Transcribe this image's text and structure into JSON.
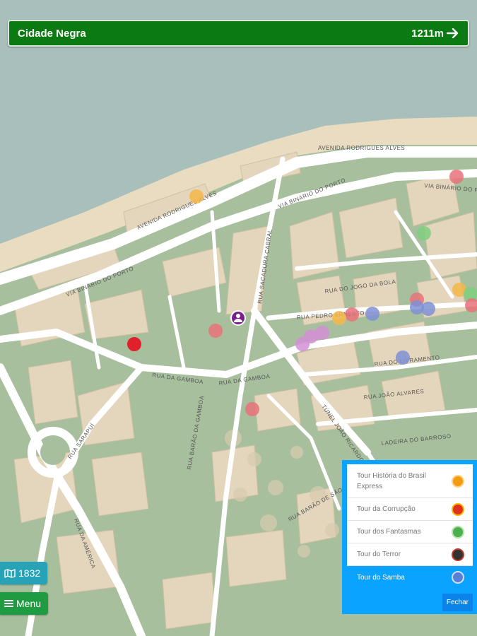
{
  "header": {
    "title": "Cidade Negra",
    "distance": "1211m"
  },
  "year_button": {
    "label": "1832",
    "icon": "map-icon"
  },
  "menu_button": {
    "label": "Menu",
    "icon": "hamburger-icon"
  },
  "streets": [
    "AVENIDA RODRIGUES ALVES",
    "AVENIDA RODRIGUES ALVES",
    "VIA BINÁRIO DO PORTO",
    "VIA BINÁRIO DO PORTO",
    "VIA BINÁRIO DO PORTO",
    "RUA SACADURA CABRAL",
    "RUA DO JOGO DA BOLA",
    "RUA PEDRO ERNESTO",
    "RUA DA GAMBOA",
    "RUA DA GAMBOA",
    "RUA BARÃO DA GAMBOA",
    "TÚNEL JOÃO RICARDO",
    "RUA DO LIVRAMENTO",
    "RUA JOÃO ALVARES",
    "RUA SARAPUÍ",
    "RUA DA AMÉRICA",
    "LADEIRA DO BARROSO",
    "RUA BARÃO DE SÃO FÉLIX"
  ],
  "tours": [
    {
      "label": "Tour História do Brasil Express",
      "icon": "history-icon",
      "color": "#f39c12",
      "active": false
    },
    {
      "label": "Tour da Corrupção",
      "icon": "corruption-icon",
      "color": "#e0301e",
      "active": false
    },
    {
      "label": "Tour dos Fantasmas",
      "icon": "ghost-icon",
      "color": "#4caf50",
      "active": false
    },
    {
      "label": "Tour do Terror",
      "icon": "terror-icon",
      "color": "#333333",
      "active": false
    },
    {
      "label": "Tour do Samba",
      "icon": "samba-icon",
      "color": "#5b7fd6",
      "active": true
    }
  ],
  "close_button": {
    "label": "Fechar"
  },
  "poi_colors": {
    "red": "#e9717a",
    "red_active": "#e0202b",
    "orange": "#f5b74a",
    "green": "#7fcf7f",
    "purple": "#d48fd6",
    "blue": "#7f8fd6",
    "user": "#7b1f8f"
  }
}
